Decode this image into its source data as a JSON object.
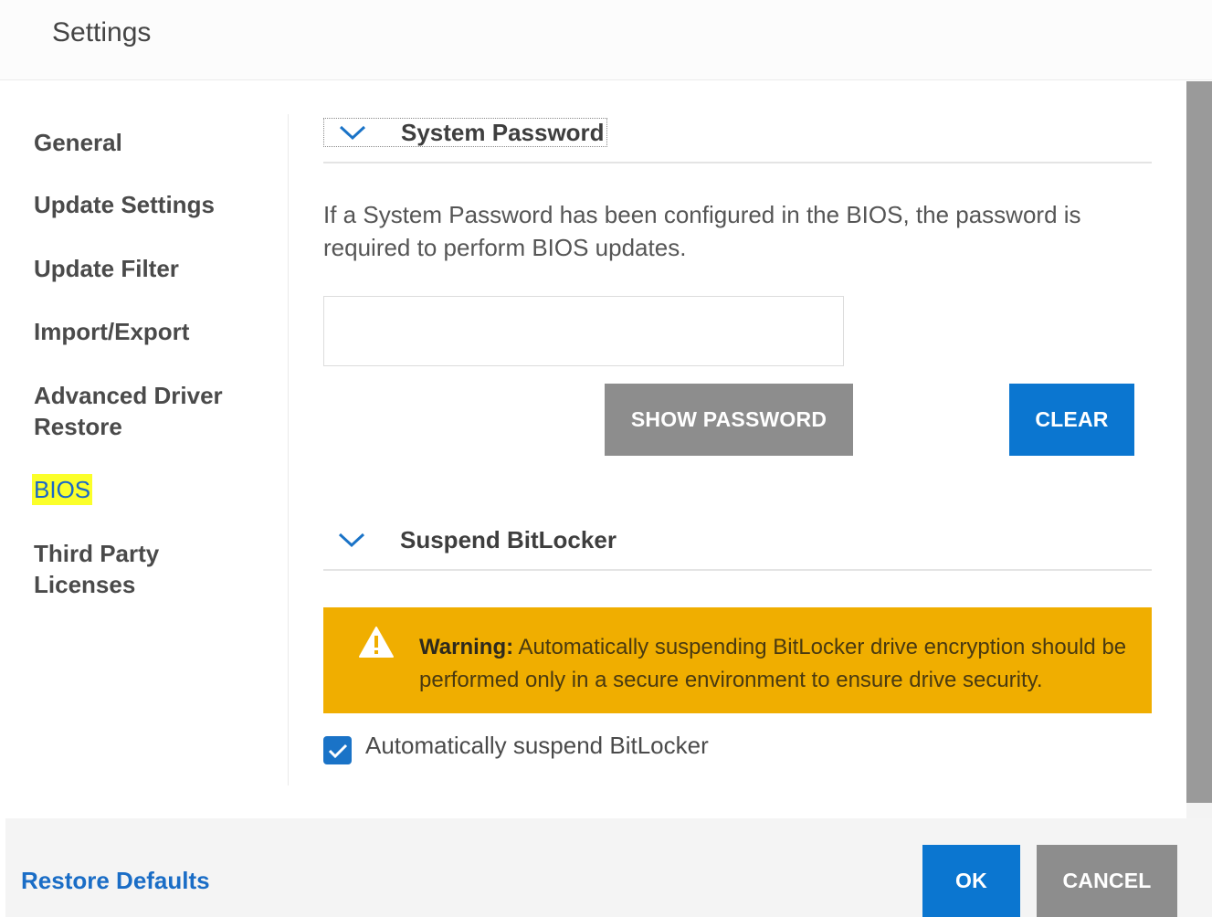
{
  "window": {
    "title": "Settings"
  },
  "nav": {
    "items": [
      {
        "label": "General"
      },
      {
        "label": "Update Settings"
      },
      {
        "label": "Update Filter"
      },
      {
        "label": "Import/Export"
      },
      {
        "label": "Advanced Driver",
        "label2": "Restore"
      },
      {
        "label": "BIOS",
        "active": true
      },
      {
        "label": "Third Party",
        "label2": "Licenses"
      }
    ]
  },
  "system_password": {
    "title": "System Password",
    "description": "If a System Password has been configured in the BIOS, the password is required to perform BIOS updates.",
    "input_value": "",
    "input_placeholder": "",
    "show_password_label": "SHOW PASSWORD",
    "clear_label": "CLEAR"
  },
  "bitlocker": {
    "title": "Suspend BitLocker",
    "warning_label": "Warning:",
    "warning_text": "Automatically suspending BitLocker drive encryption should be performed only in a secure environment to ensure drive security.",
    "checkbox_label": "Automatically suspend BitLocker",
    "checkbox_checked": true
  },
  "footer": {
    "restore_defaults_label": "Restore Defaults",
    "ok_label": "OK",
    "cancel_label": "CANCEL"
  },
  "colors": {
    "accent_blue": "#0b76d0",
    "link_blue": "#1a6dc6",
    "warning_bg": "#f0ae00",
    "highlight_yellow": "#fbff2a",
    "button_gray": "#8d8d8d"
  }
}
